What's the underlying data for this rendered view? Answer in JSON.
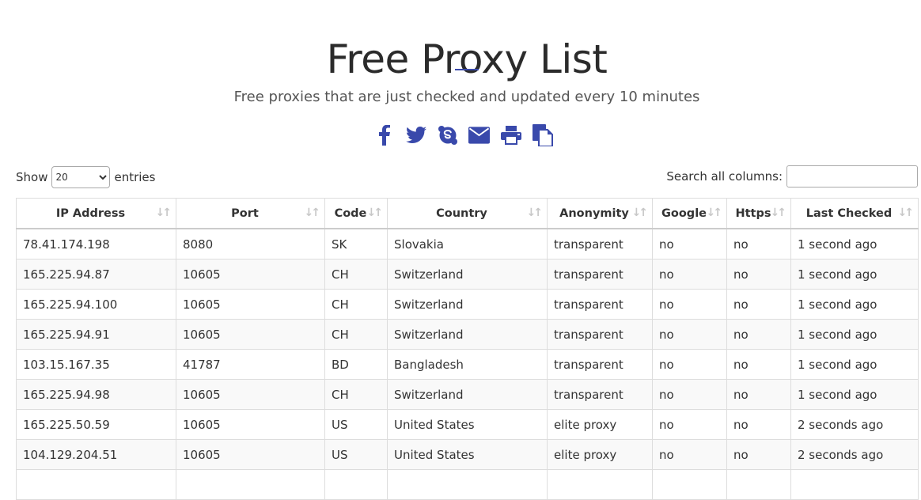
{
  "header": {
    "title": "Free Proxy List",
    "subtitle": "Free proxies that are just checked and updated every 10 minutes",
    "accent_color": "#3949ab"
  },
  "share_icons": [
    "facebook-icon",
    "twitter-icon",
    "skype-icon",
    "email-icon",
    "print-icon",
    "copy-icon"
  ],
  "controls": {
    "show_label": "Show",
    "entries_value": "20",
    "entries_label": "entries",
    "search_label": "Search all columns:",
    "search_value": ""
  },
  "table": {
    "columns": [
      "IP Address",
      "Port",
      "Code",
      "Country",
      "Anonymity",
      "Google",
      "Https",
      "Last Checked"
    ],
    "rows": [
      [
        "78.41.174.198",
        "8080",
        "SK",
        "Slovakia",
        "transparent",
        "no",
        "no",
        "1 second ago"
      ],
      [
        "165.225.94.87",
        "10605",
        "CH",
        "Switzerland",
        "transparent",
        "no",
        "no",
        "1 second ago"
      ],
      [
        "165.225.94.100",
        "10605",
        "CH",
        "Switzerland",
        "transparent",
        "no",
        "no",
        "1 second ago"
      ],
      [
        "165.225.94.91",
        "10605",
        "CH",
        "Switzerland",
        "transparent",
        "no",
        "no",
        "1 second ago"
      ],
      [
        "103.15.167.35",
        "41787",
        "BD",
        "Bangladesh",
        "transparent",
        "no",
        "no",
        "1 second ago"
      ],
      [
        "165.225.94.98",
        "10605",
        "CH",
        "Switzerland",
        "transparent",
        "no",
        "no",
        "1 second ago"
      ],
      [
        "165.225.50.59",
        "10605",
        "US",
        "United States",
        "elite proxy",
        "no",
        "no",
        "2 seconds ago"
      ],
      [
        "104.129.204.51",
        "10605",
        "US",
        "United States",
        "elite proxy",
        "no",
        "no",
        "2 seconds ago"
      ],
      [
        "",
        "",
        "",
        "",
        "",
        "",
        "",
        ""
      ]
    ]
  }
}
